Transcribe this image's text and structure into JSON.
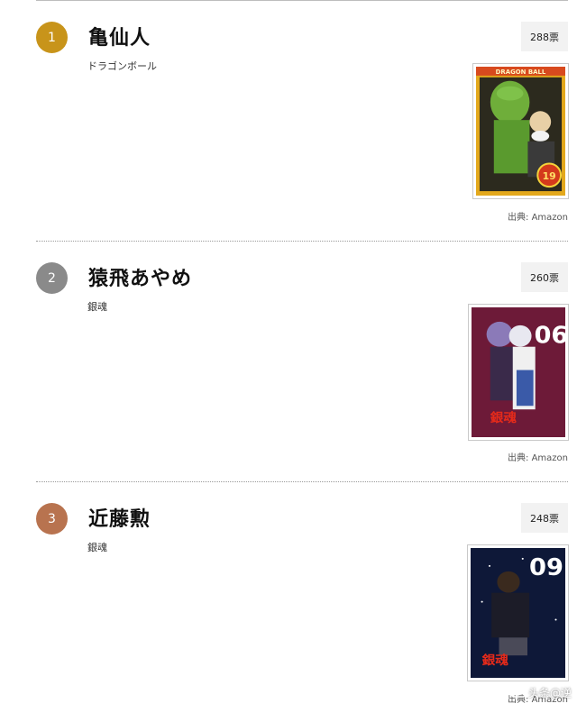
{
  "entries": [
    {
      "rank": "1",
      "name": "亀仙人",
      "series": "ドラゴンボール",
      "votes": "288票",
      "source": "出典: Amazon",
      "rank_color": "#c8941a",
      "cover": {
        "title_text": "DRAGON BALL",
        "volume": "19"
      }
    },
    {
      "rank": "2",
      "name": "猿飛あやめ",
      "series": "銀魂",
      "votes": "260票",
      "source": "出典: Amazon",
      "rank_color": "#8a8a8a",
      "cover": {
        "title_text": "銀魂",
        "volume": "06"
      }
    },
    {
      "rank": "3",
      "name": "近藤勲",
      "series": "銀魂",
      "votes": "248票",
      "source": "出典: Amazon",
      "rank_color": "#b8734f",
      "cover": {
        "title_text": "銀魂",
        "volume": "09"
      }
    }
  ],
  "watermark": {
    "text": "头条@逆",
    "icon": "camera-icon"
  }
}
